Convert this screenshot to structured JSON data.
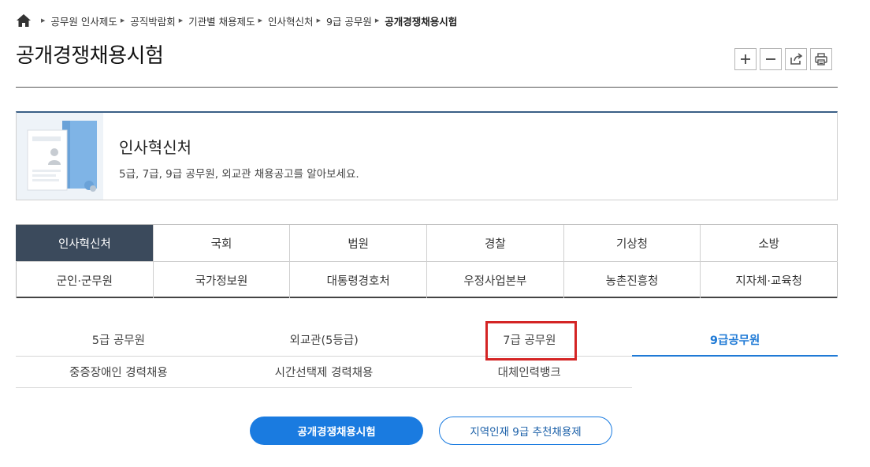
{
  "breadcrumb": {
    "items": [
      "공무원 인사제도",
      "공직박람회",
      "기관별 채용제도",
      "인사혁신처",
      "9급 공무원",
      "공개경쟁채용시험"
    ]
  },
  "page": {
    "title": "공개경쟁채용시험"
  },
  "tools": {
    "zoom_in": "zoom-in-icon",
    "zoom_out": "zoom-out-icon",
    "share": "share-icon",
    "print": "print-icon"
  },
  "org": {
    "name": "인사혁신처",
    "description": "5급, 7급, 9급 공무원, 외교관 채용공고를 알아보세요."
  },
  "org_tabs": {
    "row1": [
      "인사혁신처",
      "국회",
      "법원",
      "경찰",
      "기상청",
      "소방"
    ],
    "row2": [
      "군인·군무원",
      "국가정보원",
      "대통령경호처",
      "우정사업본부",
      "농촌진흥청",
      "지자체·교육청"
    ],
    "active": "인사혁신처"
  },
  "sub_tabs": {
    "row1": [
      "5급 공무원",
      "외교관(5등급)",
      "7급 공무원",
      "9급공무원"
    ],
    "row2": [
      "중증장애인 경력채용",
      "시간선택제 경력채용",
      "대체인력뱅크"
    ],
    "active": "9급공무원"
  },
  "buttons": {
    "primary": "공개경쟁채용시험",
    "secondary": "지역인재 9급 추천채용제"
  },
  "colors": {
    "accent": "#1a7be0",
    "active_org_tab": "#3b4a5c",
    "highlight": "#d42424"
  }
}
